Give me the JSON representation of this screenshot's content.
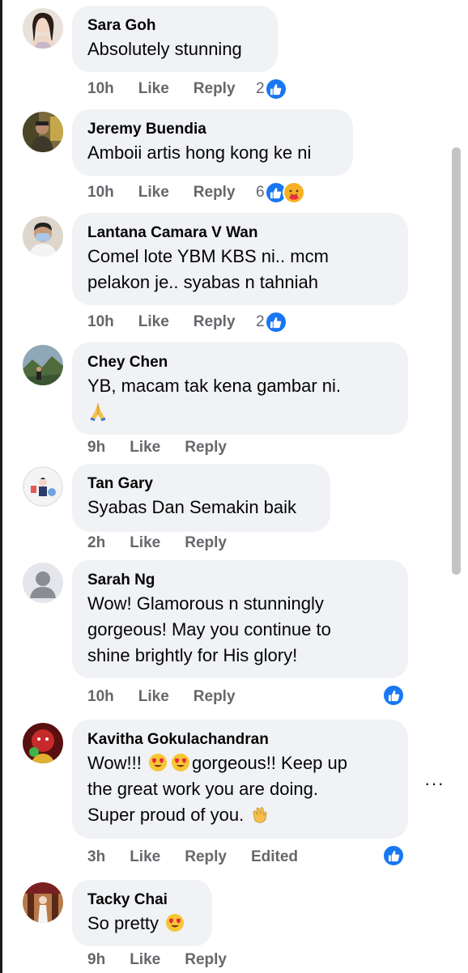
{
  "comments": [
    {
      "author": "Sara Goh",
      "text": "Absolutely stunning",
      "time": "10h",
      "like": "Like",
      "reply": "Reply",
      "reaction_count": "2"
    },
    {
      "author": "Jeremy Buendia",
      "text": "Amboii artis hong kong ke ni",
      "time": "10h",
      "like": "Like",
      "reply": "Reply",
      "reaction_count": "6"
    },
    {
      "author": "Lantana Camara V Wan",
      "text_line1": "Comel lote YBM KBS ni.. mcm",
      "text_line2": "pelakon je.. syabas n tahniah",
      "time": "10h",
      "like": "Like",
      "reply": "Reply",
      "reaction_count": "2"
    },
    {
      "author": "Chey Chen",
      "text": "YB, macam tak kena gambar ni.",
      "time": "9h",
      "like": "Like",
      "reply": "Reply"
    },
    {
      "author": "Tan Gary",
      "text": "Syabas Dan Semakin baik",
      "time": "2h",
      "like": "Like",
      "reply": "Reply"
    },
    {
      "author": "Sarah Ng",
      "text_line1": "Wow! Glamorous n stunningly",
      "text_line2": "gorgeous! May you continue to",
      "text_line3": "shine brightly for His glory!",
      "time": "10h",
      "like": "Like",
      "reply": "Reply"
    },
    {
      "author": "Kavitha Gokulachandran",
      "text_line1_a": "Wow!!!",
      "text_line1_b": "gorgeous!! Keep up",
      "text_line2": "the great work you are doing.",
      "text_line3": "Super proud of you.",
      "time": "3h",
      "like": "Like",
      "reply": "Reply",
      "edited": "Edited"
    },
    {
      "author": "Tacky Chai",
      "text": "So pretty",
      "time": "9h",
      "like": "Like",
      "reply": "Reply"
    }
  ],
  "more_options": "···",
  "colors": {
    "bubble": "#f0f2f5",
    "like_blue": "#1877f2",
    "meta_gray": "#65676b"
  }
}
